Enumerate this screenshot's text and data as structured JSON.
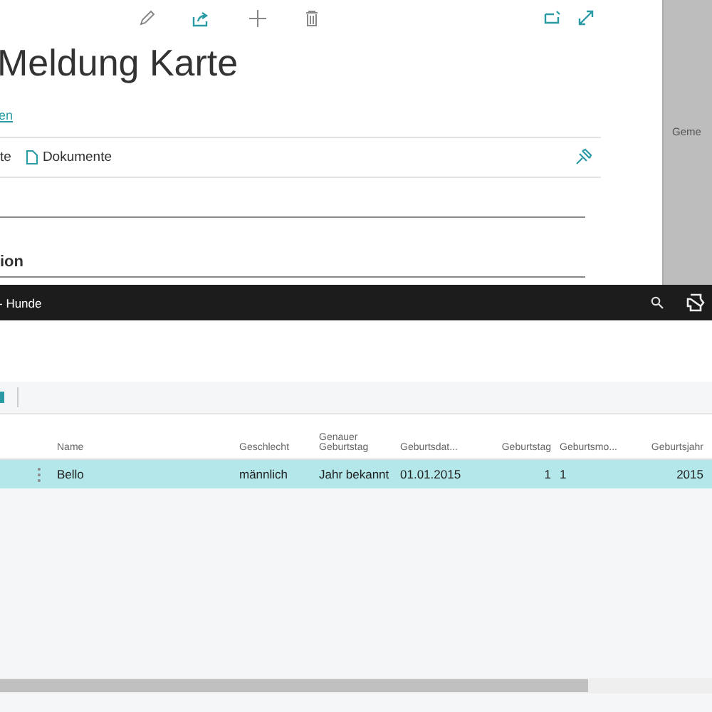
{
  "card": {
    "title": "Meldung Karte",
    "link": "en",
    "tabs": [
      {
        "label": "te",
        "icon": false
      },
      {
        "label": "Dokumente",
        "icon": true
      }
    ],
    "section": "ion"
  },
  "backdrop": {
    "column_label": "Geme"
  },
  "window": {
    "title": "- Hunde"
  },
  "table": {
    "columns": [
      {
        "label": "Name",
        "numeric": false
      },
      {
        "label": "Geschlecht",
        "numeric": false
      },
      {
        "label": "Genauer Geburtstag",
        "numeric": false
      },
      {
        "label": "Geburtsdat...",
        "numeric": false
      },
      {
        "label": "Geburtstag",
        "numeric": true
      },
      {
        "label": "Geburtsmo...",
        "numeric": false
      },
      {
        "label": "Geburtsjahr",
        "numeric": true
      }
    ],
    "rows": [
      {
        "selected": true,
        "cells": [
          "Bello",
          "männlich",
          "Jahr bekannt",
          "01.01.2015",
          "1",
          "1",
          "2015"
        ]
      }
    ]
  }
}
